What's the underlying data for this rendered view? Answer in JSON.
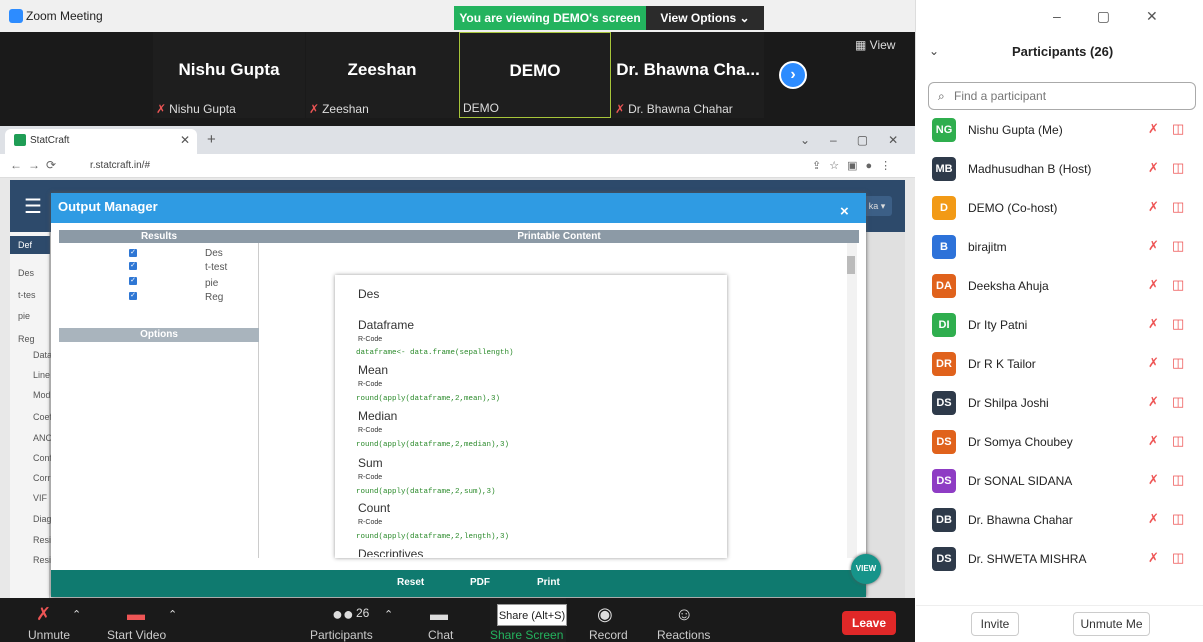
{
  "window": {
    "title": "Zoom Meeting",
    "viewing_banner": "You are viewing DEMO's screen",
    "view_options": "View Options ⌄",
    "view_button": "View"
  },
  "videos": [
    {
      "name": "Nishu Gupta",
      "label": "Nishu Gupta",
      "muted": true
    },
    {
      "name": "Zeeshan",
      "label": "Zeeshan",
      "muted": true
    },
    {
      "name": "DEMO",
      "label": "DEMO",
      "muted": false
    },
    {
      "name": "Dr. Bhawna Cha...",
      "label": "Dr. Bhawna Chahar",
      "muted": true
    }
  ],
  "browser": {
    "tab_title": "StatCraft",
    "url": "r.statcraft.in/#"
  },
  "app": {
    "sidebar": [
      "Def",
      "Des",
      "t-tes",
      "pie",
      "Reg",
      "Data",
      "Line",
      "Mod",
      "Coef",
      "ANC",
      "Conf",
      "Corr",
      "VIF",
      "Diag",
      "Resi",
      "Resi"
    ],
    "user_button": "ka ▾"
  },
  "modal": {
    "title": "Output Manager",
    "close": "×",
    "results_header": "Results",
    "printable_header": "Printable Content",
    "options_header": "Options",
    "results": [
      "Des",
      "t-test",
      "pie",
      "Reg"
    ],
    "doc": {
      "title": "Des",
      "sections": [
        {
          "heading": "Dataframe",
          "label": "R-Code",
          "code": "dataframe<- data.frame(sepallength)"
        },
        {
          "heading": "Mean",
          "label": "R-Code",
          "code": "round(apply(dataframe,2,mean),3)"
        },
        {
          "heading": "Median",
          "label": "R-Code",
          "code": "round(apply(dataframe,2,median),3)"
        },
        {
          "heading": "Sum",
          "label": "R-Code",
          "code": "round(apply(dataframe,2,sum),3)"
        },
        {
          "heading": "Count",
          "label": "R-Code",
          "code": "round(apply(dataframe,2,length),3)"
        }
      ],
      "trailing": "Descriptives"
    },
    "footer": {
      "reset": "Reset",
      "pdf": "PDF",
      "print": "Print"
    },
    "view_badge": "VIEW"
  },
  "toolbar": {
    "unmute": "Unmute",
    "start_video": "Start Video",
    "participants": "Participants",
    "participants_count": "26",
    "chat": "Chat",
    "share_screen": "Share Screen",
    "share_tip": "Share (Alt+S)",
    "record": "Record",
    "reactions": "Reactions",
    "leave": "Leave"
  },
  "participants": {
    "title": "Participants (26)",
    "search_placeholder": "Find a participant",
    "list": [
      {
        "initials": "NG",
        "name": "Nishu Gupta (Me)",
        "color": "#2fae4e"
      },
      {
        "initials": "MB",
        "name": "Madhusudhan B (Host)",
        "color": "#2e3a4a"
      },
      {
        "initials": "D",
        "name": "DEMO (Co-host)",
        "color": "#f29a16"
      },
      {
        "initials": "B",
        "name": "birajitm",
        "color": "#2d72d9"
      },
      {
        "initials": "DA",
        "name": "Deeksha Ahuja",
        "color": "#e0621c"
      },
      {
        "initials": "DI",
        "name": "Dr Ity Patni",
        "color": "#2fae4e"
      },
      {
        "initials": "DR",
        "name": "Dr R K Tailor",
        "color": "#e0621c"
      },
      {
        "initials": "DS",
        "name": "Dr Shilpa Joshi",
        "color": "#2e3a4a"
      },
      {
        "initials": "DS",
        "name": "Dr Somya Choubey",
        "color": "#e0621c"
      },
      {
        "initials": "DS",
        "name": "Dr SONAL SIDANA",
        "color": "#8e3cc4"
      },
      {
        "initials": "DB",
        "name": "Dr. Bhawna Chahar",
        "color": "#2e3a4a"
      },
      {
        "initials": "DS",
        "name": "Dr. SHWETA MISHRA",
        "color": "#2e3a4a"
      }
    ],
    "invite": "Invite",
    "unmute_me": "Unmute Me"
  }
}
